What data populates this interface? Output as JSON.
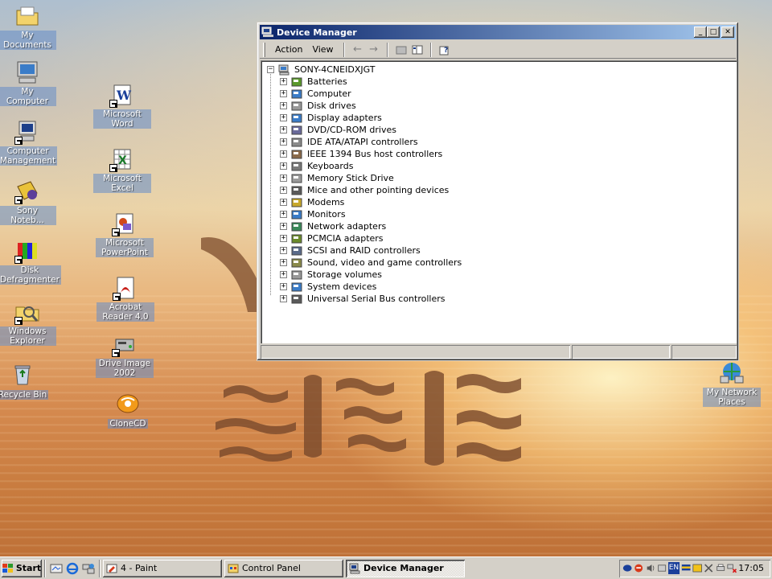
{
  "desktop": {
    "icons": [
      {
        "label": "My Documents"
      },
      {
        "label": "My Computer"
      },
      {
        "label": "Computer Management"
      },
      {
        "label": "Sony Noteb..."
      },
      {
        "label": "Disk Defragmenter"
      },
      {
        "label": "Windows Explorer"
      },
      {
        "label": "Recycle Bin"
      },
      {
        "label": "Microsoft Word"
      },
      {
        "label": "Microsoft Excel"
      },
      {
        "label": "Microsoft PowerPoint"
      },
      {
        "label": "Acrobat Reader 4.0"
      },
      {
        "label": "Drive Image 2002"
      },
      {
        "label": "CloneCD"
      },
      {
        "label": "My Network Places"
      }
    ]
  },
  "window": {
    "title": "Device Manager",
    "menu": {
      "action": "Action",
      "view": "View"
    },
    "tree": {
      "root": "SONY-4CNEIDXJGT",
      "items": [
        {
          "label": "Batteries",
          "icon": "battery-icon"
        },
        {
          "label": "Computer",
          "icon": "computer-icon"
        },
        {
          "label": "Disk drives",
          "icon": "disk-drive-icon"
        },
        {
          "label": "Display adapters",
          "icon": "display-adapter-icon"
        },
        {
          "label": "DVD/CD-ROM drives",
          "icon": "cdrom-icon"
        },
        {
          "label": "IDE ATA/ATAPI controllers",
          "icon": "ide-controller-icon"
        },
        {
          "label": "IEEE 1394 Bus host controllers",
          "icon": "ieee1394-icon"
        },
        {
          "label": "Keyboards",
          "icon": "keyboard-icon"
        },
        {
          "label": "Memory Stick Drive",
          "icon": "memory-stick-icon"
        },
        {
          "label": "Mice and other pointing devices",
          "icon": "mouse-icon"
        },
        {
          "label": "Modems",
          "icon": "modem-icon"
        },
        {
          "label": "Monitors",
          "icon": "monitor-icon"
        },
        {
          "label": "Network adapters",
          "icon": "network-adapter-icon"
        },
        {
          "label": "PCMCIA adapters",
          "icon": "pcmcia-icon"
        },
        {
          "label": "SCSI and RAID controllers",
          "icon": "scsi-icon"
        },
        {
          "label": "Sound, video and game controllers",
          "icon": "sound-icon"
        },
        {
          "label": "Storage volumes",
          "icon": "storage-icon"
        },
        {
          "label": "System devices",
          "icon": "system-devices-icon"
        },
        {
          "label": "Universal Serial Bus controllers",
          "icon": "usb-icon"
        }
      ]
    }
  },
  "taskbar": {
    "start_label": "Start",
    "tasks": [
      {
        "label": "4 - Paint"
      },
      {
        "label": "Control Panel"
      },
      {
        "label": "Device Manager"
      }
    ],
    "tray": {
      "language": "EN",
      "clock": "17:05"
    }
  },
  "colors": {
    "titlebar_start": "#0a246a",
    "titlebar_end": "#a6caf0",
    "window_face": "#d4d0c8"
  }
}
